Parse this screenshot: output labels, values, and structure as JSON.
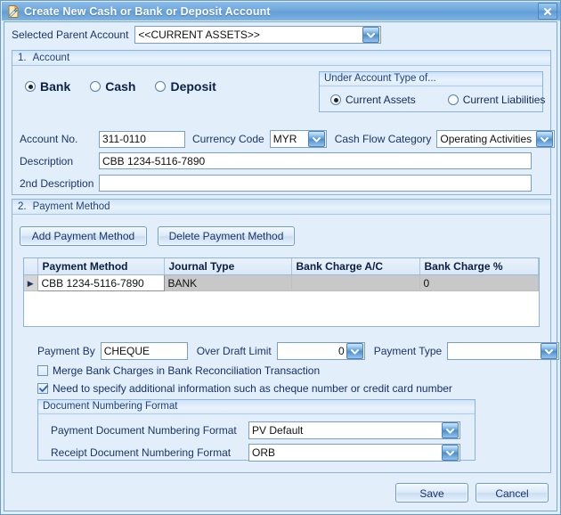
{
  "window": {
    "title": "Create New Cash or Bank or Deposit Account",
    "icon": "document-edit-icon",
    "close_label": "×",
    "accent_titlebar": "#6fa7dd",
    "accent_panel_bg": "#e3eefb",
    "accent_border": "#6a9bd1"
  },
  "parent_account": {
    "label": "Selected Parent Account",
    "value": "<<CURRENT ASSETS>>"
  },
  "section_account": {
    "number": "1.",
    "title": "Account",
    "account_kind": {
      "options": [
        "Bank",
        "Cash",
        "Deposit"
      ],
      "selected": "Bank"
    },
    "under_account_type": {
      "title": "Under Account Type of...",
      "options": [
        "Current Assets",
        "Current Liabilities"
      ],
      "selected": "Current Assets"
    },
    "fields": {
      "account_no_label": "Account No.",
      "account_no_value": "311-0110",
      "currency_code_label": "Currency Code",
      "currency_code_value": "MYR",
      "cash_flow_category_label": "Cash Flow Category",
      "cash_flow_category_value": "Operating Activities",
      "description_label": "Description",
      "description_value": "CBB 1234-5116-7890",
      "second_description_label": "2nd Description",
      "second_description_value": ""
    }
  },
  "section_payment": {
    "number": "2.",
    "title": "Payment Method",
    "buttons": {
      "add": "Add Payment Method",
      "delete": "Delete Payment Method"
    },
    "grid": {
      "columns": [
        "Payment Method",
        "Journal Type",
        "Bank Charge A/C",
        "Bank Charge %"
      ],
      "rows": [
        {
          "marker": "▶",
          "payment_method": "CBB 1234-5116-7890",
          "journal_type": "BANK",
          "bank_charge_ac": "",
          "bank_charge_pct": "0"
        }
      ]
    },
    "details": {
      "payment_by_label": "Payment By",
      "payment_by_value": "CHEQUE",
      "over_draft_limit_label": "Over Draft Limit",
      "over_draft_limit_value": "0",
      "payment_type_label": "Payment Type",
      "payment_type_value": ""
    },
    "checkboxes": [
      {
        "label": "Merge Bank Charges in Bank Reconciliation Transaction",
        "checked": false
      },
      {
        "label": "Need to specify additional information such as cheque number or credit card number",
        "checked": true
      }
    ],
    "document_numbering": {
      "title": "Document Numbering Format",
      "payment_label": "Payment Document Numbering Format",
      "payment_value": "PV Default",
      "receipt_label": "Receipt Document Numbering Format",
      "receipt_value": "ORB"
    }
  },
  "footer": {
    "save": "Save",
    "cancel": "Cancel"
  }
}
